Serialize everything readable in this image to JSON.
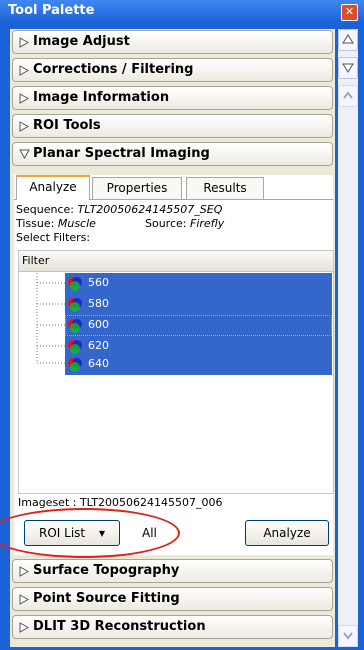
{
  "window": {
    "title": "Tool Palette",
    "close_symbol": "✕"
  },
  "sections": {
    "image_adjust": "Image Adjust",
    "corrections": "Corrections / Filtering",
    "image_info": "Image Information",
    "roi_tools": "ROI Tools",
    "planar": "Planar Spectral Imaging",
    "surface": "Surface Topography",
    "point_source": "Point Source Fitting",
    "dlit": "DLIT 3D Reconstruction"
  },
  "tabs": {
    "analyze": "Analyze",
    "properties": "Properties",
    "results": "Results"
  },
  "info": {
    "sequence_label": "Sequence:",
    "sequence_value": "TLT20050624145507_SEQ",
    "tissue_label": "Tissue:",
    "tissue_value": "Muscle",
    "source_label": "Source:",
    "source_value": "Firefly",
    "select_filters": "Select Filters:"
  },
  "filter_list": {
    "header": "Filter",
    "items": [
      "560",
      "580",
      "600",
      "620",
      "640"
    ]
  },
  "footer": {
    "imageset": "Imageset : TLT20050624145507_006",
    "roi_button": "ROI List",
    "dropdown_arrow": "▾",
    "all_label": "All",
    "analyze_button": "Analyze"
  },
  "colors": {
    "titlebar": "#1c5fd8",
    "selection": "#3566cb",
    "annotation": "#e0201a"
  }
}
